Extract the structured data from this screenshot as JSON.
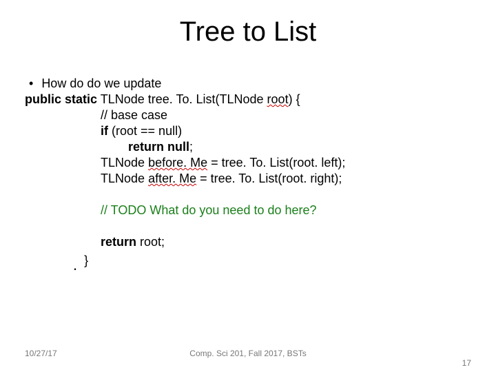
{
  "title": "Tree to List",
  "bullet": "How do do we update",
  "code": {
    "sig_prefix": "public static",
    "sig_type": "TLNode",
    "sig_fn": "tree. To. List(TLNode",
    "sig_arg": "root",
    "sig_close": ") {",
    "c1": "// base case",
    "c2_if": "if",
    "c2_cond": "(root == null)",
    "c3_ret": "return null",
    "c3_semicolon": ";",
    "c4_type": "TLNode",
    "c4_var": "before. Me",
    "c4_rest": " = tree. To. List(root. left);",
    "c5_type": "TLNode",
    "c5_var": "after. Me",
    "c5_rest": " = tree. To. List(root. right);",
    "todo": "// TODO What do you need to do here?",
    "ret_kw": "return",
    "ret_val": " root;",
    "brace": "}",
    "dot": "."
  },
  "footer": {
    "date": "10/27/17",
    "center": "Comp. Sci 201, Fall 2017,  BSTs",
    "page": "17"
  }
}
